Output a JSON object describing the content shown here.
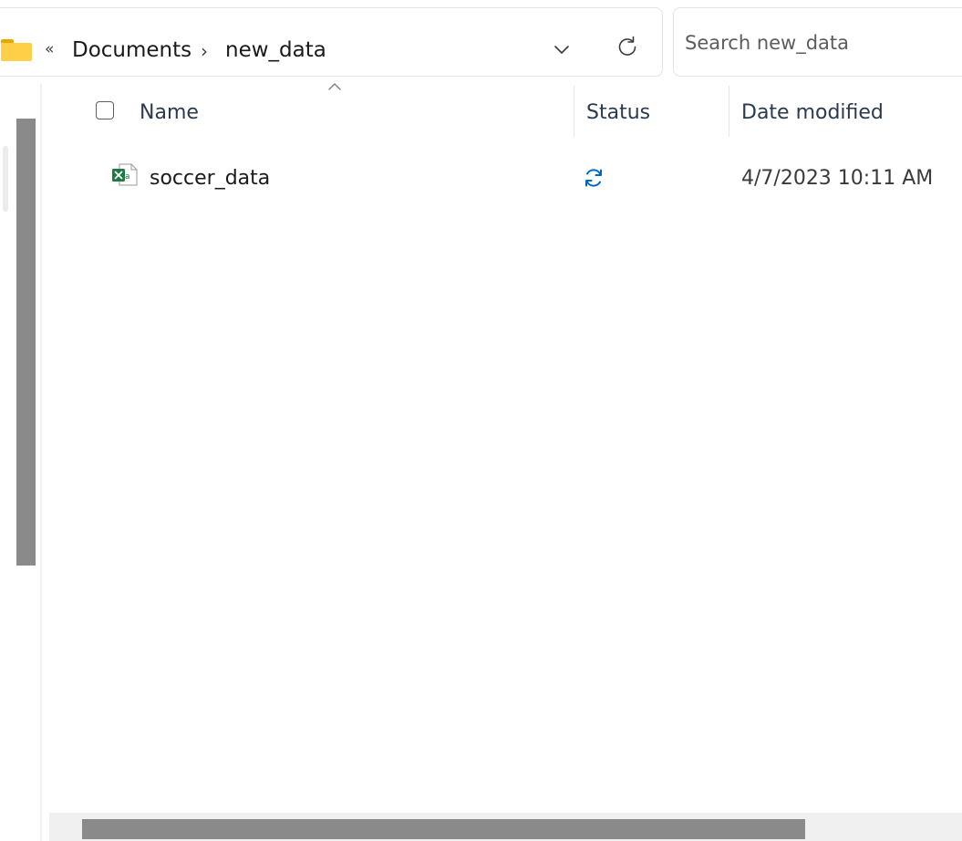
{
  "address_bar": {
    "folder_icon": "folder-icon",
    "overflow_glyph": "«",
    "breadcrumbs": [
      "Documents",
      "new_data"
    ],
    "separator_glyph": "›",
    "dropdown_icon": "chevron-down-icon",
    "refresh_icon": "refresh-icon"
  },
  "search": {
    "placeholder": "Search new_data",
    "value": ""
  },
  "columns": {
    "name": "Name",
    "status": "Status",
    "date_modified": "Date modified"
  },
  "files": [
    {
      "name": "soccer_data",
      "icon": "excel-file-icon",
      "status_icon": "sync-pending-icon",
      "date_modified": "4/7/2023 10:11 AM"
    }
  ],
  "colors": {
    "folder_yellow": "#ffcf48",
    "excel_green": "#1d7a43",
    "sync_blue": "#0067c0",
    "header_text": "#2b3a4d",
    "scrollbar": "#8a8a8a"
  }
}
